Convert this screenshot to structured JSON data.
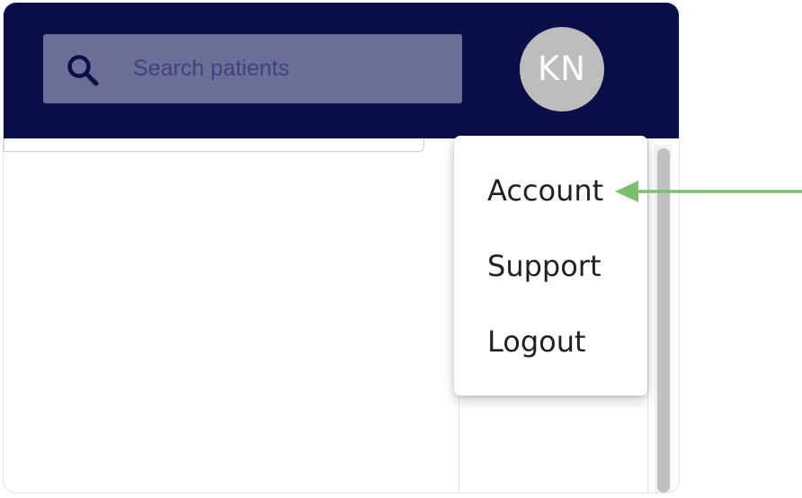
{
  "header": {
    "background_color": "#0b0f47",
    "search": {
      "placeholder": "Search patients",
      "icon": "search-icon"
    },
    "avatar": {
      "initials": "KN",
      "color": "#bdbdbd"
    }
  },
  "user_menu": {
    "items": [
      {
        "label": "Account"
      },
      {
        "label": "Support"
      },
      {
        "label": "Logout"
      }
    ]
  },
  "annotation": {
    "arrow_color": "#7cbf6e",
    "points_to": "Account"
  }
}
